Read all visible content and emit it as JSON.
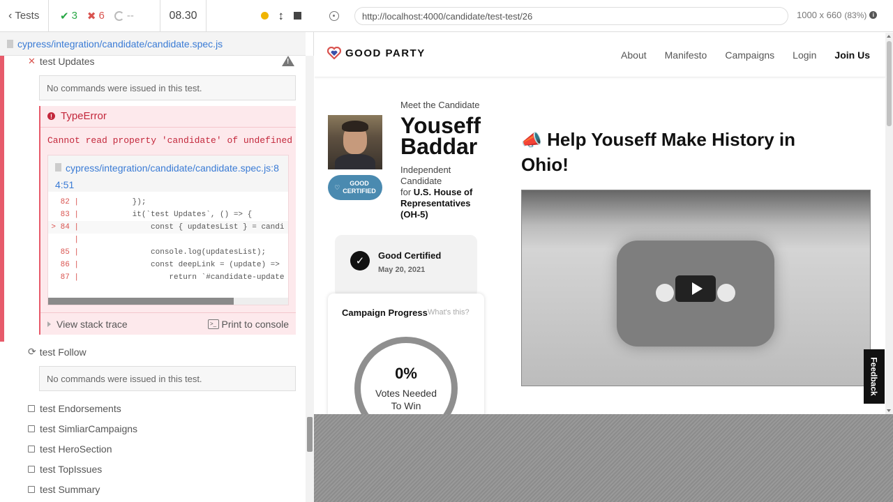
{
  "header": {
    "back_label": "Tests",
    "passed": "3",
    "failed": "6",
    "pending": "--",
    "duration": "08.30"
  },
  "spec_path": "cypress/integration/candidate/candidate.spec.js",
  "tests": {
    "failed_test": {
      "label": "test Updates",
      "no_commands": "No commands were issued in this test.",
      "error": {
        "name": "TypeError",
        "message": "Cannot read property 'candidate' of undefined",
        "file_line1": "cypress/integration/candidate/candidate.spec.js:8",
        "file_line2": "4:51",
        "code_lines": [
          {
            "num": "82",
            "code": "          });"
          },
          {
            "num": "83",
            "code": "          it(`test Updates`, () => {"
          },
          {
            "num": "> 84",
            "code": "              const { updatesList } = candi"
          },
          {
            "num": "",
            "code": ""
          },
          {
            "num": "85",
            "code": "              console.log(updatesList);"
          },
          {
            "num": "86",
            "code": "              const deepLink = (update) =>"
          },
          {
            "num": "87",
            "code": "                  return `#candidate-update"
          }
        ],
        "stack_trace_label": "View stack trace",
        "print_label": "Print to console"
      }
    },
    "running_test": {
      "label": "test Follow",
      "no_commands": "No commands were issued in this test."
    },
    "queued": [
      "test Endorsements",
      "test SimliarCampaigns",
      "test HeroSection",
      "test TopIssues",
      "test Summary"
    ]
  },
  "aut": {
    "url": "http://localhost:4000/candidate/test-test/26",
    "viewport": "1000 x 660",
    "scale": "(83%)"
  },
  "app": {
    "brand": "GOOD PARTY",
    "nav": [
      "About",
      "Manifesto",
      "Campaigns",
      "Login",
      "Join Us"
    ],
    "meet": "Meet the Candidate",
    "first_name": "Youseff",
    "last_name": "Baddar",
    "party_line1": "Independent",
    "party_line2": "Candidate",
    "for_label": "for ",
    "office": "U.S. House of Representatives (OH-5)",
    "badge_line1": "GOOD",
    "badge_line2": "CERTIFIED",
    "cert_title": "Good Certified",
    "cert_date": "May 20, 2021",
    "progress_title": "Campaign Progress",
    "progress_help": "What's this?",
    "progress_pct": "0%",
    "progress_label": "Votes Needed To Win",
    "headline": "Help Youseff Make History in Ohio!",
    "feedback": "Feedback"
  },
  "colors": {
    "pass": "#28a745",
    "fail": "#d9534f",
    "link": "#3a7bd5",
    "badge": "#4a8ab0"
  }
}
